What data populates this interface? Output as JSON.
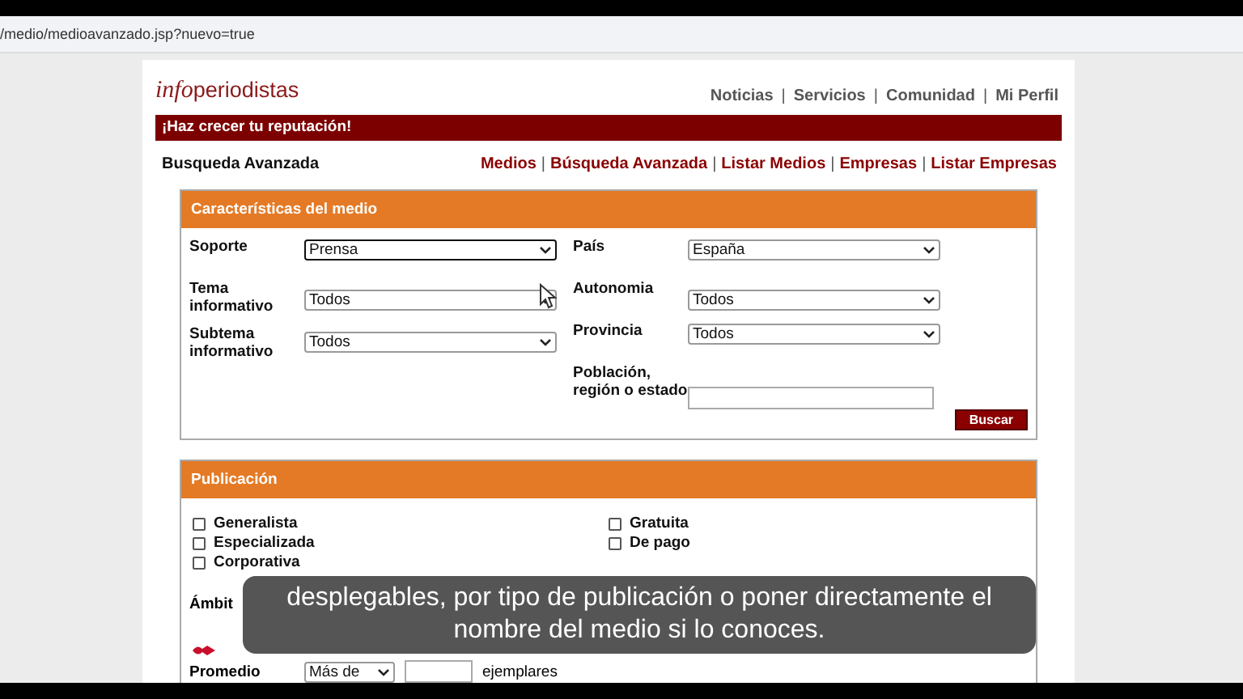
{
  "address_bar": {
    "url": "/medio/medioavanzado.jsp?nuevo=true"
  },
  "logo": {
    "italic": "info",
    "rest": "periodistas"
  },
  "separator": "|",
  "top_nav": [
    "Noticias",
    "Servicios",
    "Comunidad",
    "Mi Perfil"
  ],
  "banner": "¡Haz crecer tu reputación!",
  "page_title": "Busqueda Avanzada",
  "sub_nav": [
    "Medios",
    "Búsqueda Avanzada",
    "Listar Medios",
    "Empresas",
    "Listar Empresas"
  ],
  "characteristics": {
    "title": "Características del medio",
    "left": [
      {
        "label": "Soporte",
        "kind": "select",
        "value": "Prensa",
        "focused": true
      },
      {
        "label": "Tema informativo",
        "kind": "select",
        "value": "Todos",
        "focused": false
      },
      {
        "label": "Subtema informativo",
        "kind": "select",
        "value": "Todos",
        "focused": false
      }
    ],
    "right": [
      {
        "label": "País",
        "kind": "select",
        "value": "España",
        "focused": false
      },
      {
        "label": "Autonomia",
        "kind": "select",
        "value": "Todos",
        "focused": false
      },
      {
        "label": "Provincia",
        "kind": "select",
        "value": "Todos",
        "focused": false
      },
      {
        "label": "Población, región o estado",
        "kind": "text",
        "focused": false
      }
    ],
    "button": "Buscar"
  },
  "publication": {
    "title": "Publicación",
    "left_options": [
      {
        "label": "Generalista",
        "checked": false
      },
      {
        "label": "Especializada",
        "checked": false
      },
      {
        "label": "Corporativa",
        "checked": false
      }
    ],
    "right_options": [
      {
        "label": "Gratuita",
        "checked": false
      },
      {
        "label": "De pago",
        "checked": false
      }
    ],
    "scope_label": "Ámbit",
    "average": {
      "label": "Promedio",
      "operator": "Más de",
      "unit": "ejemplares"
    }
  },
  "subtitle": [
    "desplegables, por tipo de publicación o poner directamente el",
    "nombre del medio si lo conoces."
  ]
}
